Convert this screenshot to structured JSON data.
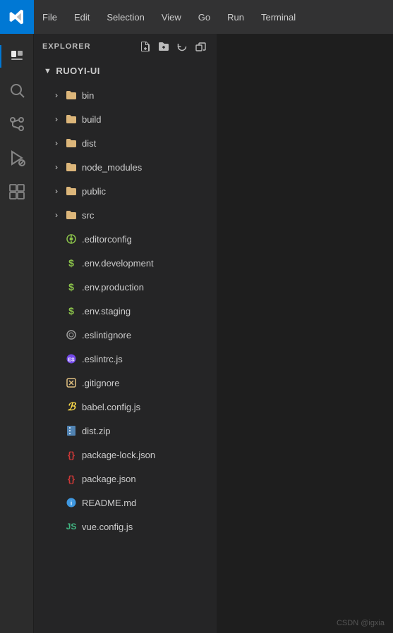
{
  "titlebar": {
    "menu_items": [
      "File",
      "Edit",
      "Selection",
      "View",
      "Go",
      "Run",
      "Terminal"
    ]
  },
  "sidebar_header": "EXPLORER",
  "sidebar_more_label": "More options",
  "root_folder": "RUOYI-UI",
  "toolbar": {
    "new_file_title": "New File",
    "new_folder_title": "New Folder",
    "refresh_title": "Refresh Explorer",
    "collapse_title": "Collapse Folders in Explorer"
  },
  "tree_items": [
    {
      "type": "folder",
      "name": "bin",
      "indent": 1
    },
    {
      "type": "folder",
      "name": "build",
      "indent": 1
    },
    {
      "type": "folder",
      "name": "dist",
      "indent": 1
    },
    {
      "type": "folder",
      "name": "node_modules",
      "indent": 1
    },
    {
      "type": "folder",
      "name": "public",
      "indent": 1
    },
    {
      "type": "folder",
      "name": "src",
      "indent": 1
    },
    {
      "type": "file",
      "name": ".editorconfig",
      "icon_type": "editorconfig",
      "indent": 1
    },
    {
      "type": "file",
      "name": ".env.development",
      "icon_type": "env-dev",
      "indent": 1
    },
    {
      "type": "file",
      "name": ".env.production",
      "icon_type": "env-prod",
      "indent": 1
    },
    {
      "type": "file",
      "name": ".env.staging",
      "icon_type": "env-staging",
      "indent": 1
    },
    {
      "type": "file",
      "name": ".eslintignore",
      "icon_type": "eslintignore",
      "indent": 1
    },
    {
      "type": "file",
      "name": ".eslintrc.js",
      "icon_type": "eslintrc",
      "indent": 1
    },
    {
      "type": "file",
      "name": ".gitignore",
      "icon_type": "gitignore",
      "indent": 1
    },
    {
      "type": "file",
      "name": "babel.config.js",
      "icon_type": "babel",
      "indent": 1
    },
    {
      "type": "file",
      "name": "dist.zip",
      "icon_type": "distzip",
      "indent": 1
    },
    {
      "type": "file",
      "name": "package-lock.json",
      "icon_type": "pkglock",
      "indent": 1
    },
    {
      "type": "file",
      "name": "package.json",
      "icon_type": "pkg",
      "indent": 1
    },
    {
      "type": "file",
      "name": "README.md",
      "icon_type": "readme",
      "indent": 1
    },
    {
      "type": "file",
      "name": "vue.config.js",
      "icon_type": "vue",
      "indent": 1
    }
  ],
  "watermark": "CSDN @igxia"
}
